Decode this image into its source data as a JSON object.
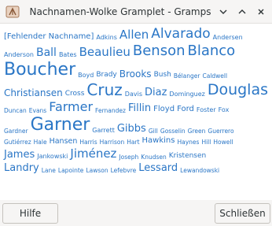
{
  "window": {
    "title": "Nachnamen-Wolke Gramplet - Gramps"
  },
  "footer": {
    "help_label": "Hilfe",
    "close_label": "Schließen"
  },
  "colors": {
    "link": "#2a76c6"
  },
  "icons": {
    "app": "gramps-tree-icon",
    "minimize": "chevron-down-icon",
    "maximize": "chevron-up-icon",
    "close": "close-icon"
  },
  "cloud": {
    "lines": [
      {
        "words": [
          {
            "text": "[Fehlender Nachname]",
            "size": 10
          },
          {
            "text": "Adkins",
            "size": 8
          },
          {
            "text": "Allen",
            "size": 15
          },
          {
            "text": "Alvarado",
            "size": 17
          },
          {
            "text": "Andersen",
            "size": 8
          }
        ]
      },
      {
        "words": [
          {
            "text": "Anderson",
            "size": 8
          },
          {
            "text": "Ball",
            "size": 14
          },
          {
            "text": "Bates",
            "size": 8
          },
          {
            "text": "Beaulieu",
            "size": 15
          },
          {
            "text": "Benson",
            "size": 18
          },
          {
            "text": "Blanco",
            "size": 18
          }
        ]
      },
      {
        "words": [
          {
            "text": "Boucher",
            "size": 22
          },
          {
            "text": "Boyd",
            "size": 8
          },
          {
            "text": "Brady",
            "size": 9
          },
          {
            "text": "Brooks",
            "size": 12
          },
          {
            "text": "Bush",
            "size": 9
          },
          {
            "text": "Bélanger",
            "size": 7.5
          },
          {
            "text": "Caldwell",
            "size": 7.5
          }
        ]
      },
      {
        "words": [
          {
            "text": "Christiansen",
            "size": 12
          },
          {
            "text": "Cross",
            "size": 9
          },
          {
            "text": "Cruz",
            "size": 20
          },
          {
            "text": "Davis",
            "size": 8
          },
          {
            "text": "Diaz",
            "size": 13
          },
          {
            "text": "Dominguez",
            "size": 8
          },
          {
            "text": "Douglas",
            "size": 19
          }
        ]
      },
      {
        "words": [
          {
            "text": "Duncan",
            "size": 7.5
          },
          {
            "text": "Evans",
            "size": 7.5
          },
          {
            "text": "Farmer",
            "size": 16
          },
          {
            "text": "Fernandez",
            "size": 7.5
          },
          {
            "text": "Fillin",
            "size": 13
          },
          {
            "text": "Floyd",
            "size": 10
          },
          {
            "text": "Ford",
            "size": 10
          },
          {
            "text": "Foster",
            "size": 8
          },
          {
            "text": "Fox",
            "size": 8
          }
        ]
      },
      {
        "words": [
          {
            "text": "Gardner",
            "size": 7.5
          },
          {
            "text": "Garner",
            "size": 22
          },
          {
            "text": "Garrett",
            "size": 8
          },
          {
            "text": "Gibbs",
            "size": 13
          },
          {
            "text": "Gill",
            "size": 7.5
          },
          {
            "text": "Gosselin",
            "size": 7.5
          },
          {
            "text": "Green",
            "size": 7.5
          },
          {
            "text": "Guerrero",
            "size": 7.5
          }
        ]
      },
      {
        "words": [
          {
            "text": "Gutiérrez",
            "size": 7.5
          },
          {
            "text": "Hale",
            "size": 7.5
          },
          {
            "text": "Hansen",
            "size": 9.5
          },
          {
            "text": "Harris",
            "size": 7.5
          },
          {
            "text": "Harrison",
            "size": 7.5
          },
          {
            "text": "Hart",
            "size": 7.5
          },
          {
            "text": "Hawkins",
            "size": 10
          },
          {
            "text": "Haynes",
            "size": 7.5
          },
          {
            "text": "Hill",
            "size": 7.5
          },
          {
            "text": "Howell",
            "size": 7.5
          }
        ]
      },
      {
        "words": [
          {
            "text": "James",
            "size": 13
          },
          {
            "text": "Jankowski",
            "size": 8
          },
          {
            "text": "Jiménez",
            "size": 15
          },
          {
            "text": "Joseph",
            "size": 7.5
          },
          {
            "text": "Knudsen",
            "size": 7.5
          },
          {
            "text": "Kristensen",
            "size": 9
          }
        ]
      },
      {
        "words": [
          {
            "text": "Landry",
            "size": 13
          },
          {
            "text": "Lane",
            "size": 7.5
          },
          {
            "text": "Lapointe",
            "size": 7.5
          },
          {
            "text": "Lawson",
            "size": 7.5
          },
          {
            "text": "Lefebvre",
            "size": 7.5
          },
          {
            "text": "Lessard",
            "size": 13
          },
          {
            "text": "Lewandowski",
            "size": 7.5
          }
        ]
      }
    ]
  }
}
